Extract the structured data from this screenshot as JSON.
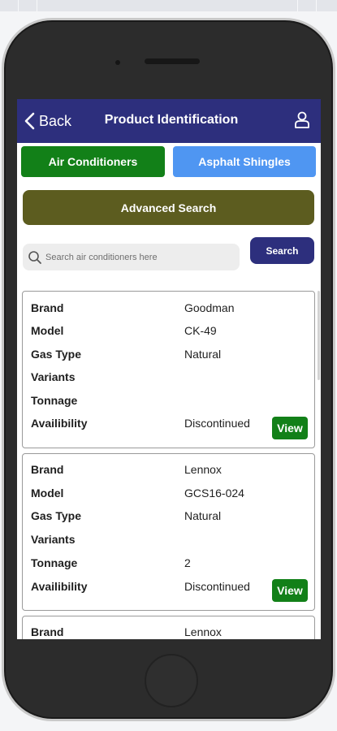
{
  "header": {
    "back_label": "Back",
    "title": "Product Identification",
    "user_icon": "user-icon"
  },
  "tabs": [
    {
      "label": "Air Conditioners",
      "color": "#128018",
      "active": true
    },
    {
      "label": "Asphalt Shingles",
      "color": "#4f96f2",
      "active": false
    }
  ],
  "advanced_search": {
    "label": "Advanced Search",
    "color": "#5c5c1f"
  },
  "search": {
    "placeholder": "Search air conditioners here",
    "value": "",
    "button_label": "Search",
    "icon": "search-icon"
  },
  "field_labels": {
    "brand": "Brand",
    "model": "Model",
    "gas_type": "Gas Type",
    "variants": "Variants",
    "tonnage": "Tonnage",
    "availability": "Availibility"
  },
  "products": [
    {
      "brand": "Goodman",
      "model": "CK-49",
      "gas_type": "Natural",
      "variants": "",
      "tonnage": "",
      "availability": "Discontinued",
      "view_label": "View"
    },
    {
      "brand": "Lennox",
      "model": "GCS16-024",
      "gas_type": "Natural",
      "variants": "",
      "tonnage": "2",
      "availability": "Discontinued",
      "view_label": "View"
    },
    {
      "brand": "Lennox"
    }
  ],
  "colors": {
    "header": "#2d2f7d",
    "primary_green": "#128018",
    "accent_blue": "#4f96f2"
  }
}
